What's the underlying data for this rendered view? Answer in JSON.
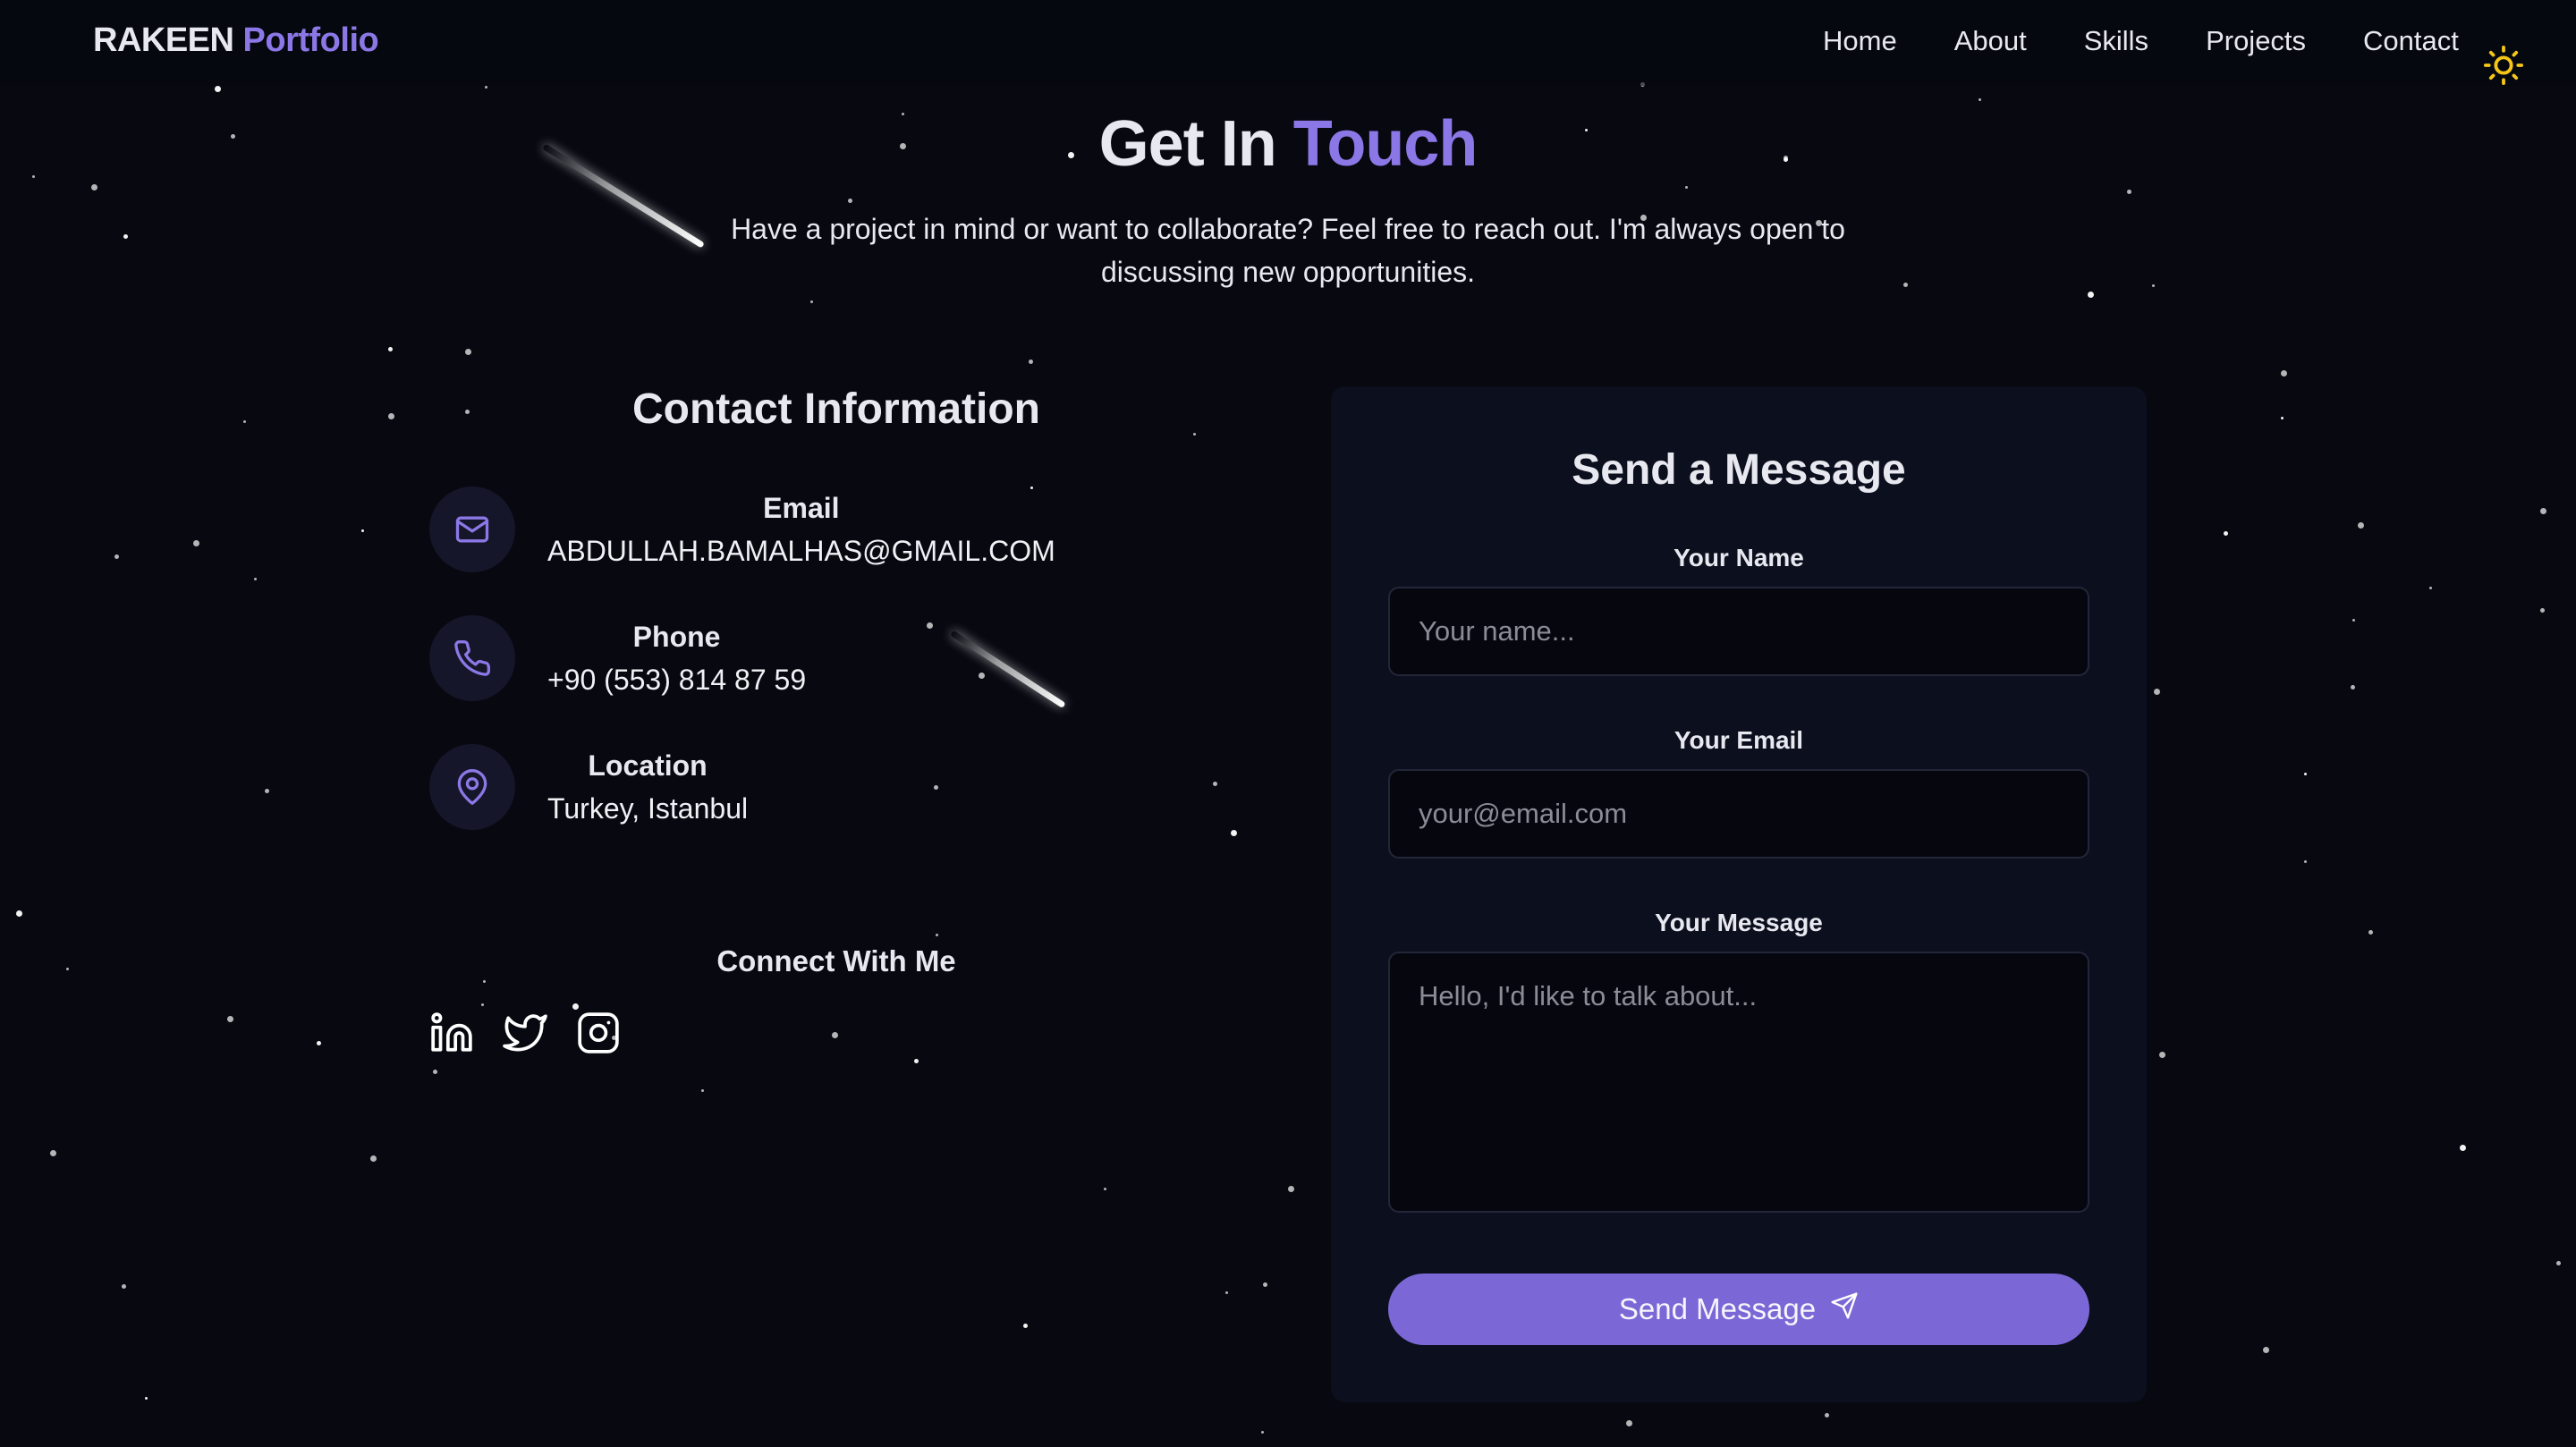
{
  "nav": {
    "brand_name": "RAKEEN",
    "brand_suffix": "Portfolio",
    "links": [
      "Home",
      "About",
      "Skills",
      "Projects",
      "Contact"
    ],
    "theme_icon": "sun-icon"
  },
  "hero": {
    "title_part1": "Get In",
    "title_part2": "Touch",
    "subtitle": "Have a project in mind or want to collaborate? Feel free to reach out. I'm always open to discussing new opportunities."
  },
  "contact_info": {
    "heading": "Contact Information",
    "items": [
      {
        "label": "Email",
        "value": "ABDULLAH.BAMALHAS@GMAIL.COM",
        "icon": "mail-icon"
      },
      {
        "label": "Phone",
        "value": "+90 (553) 814 87 59",
        "icon": "phone-icon"
      },
      {
        "label": "Location",
        "value": "Turkey, Istanbul",
        "icon": "map-pin-icon"
      }
    ],
    "connect_heading": "Connect With Me",
    "socials": [
      "linkedin-icon",
      "twitter-icon",
      "instagram-icon"
    ]
  },
  "form": {
    "heading": "Send a Message",
    "name_label": "Your Name",
    "name_placeholder": "Your name...",
    "email_label": "Your Email",
    "email_placeholder": "your@email.com",
    "message_label": "Your Message",
    "message_placeholder": "Hello, I'd like to talk about...",
    "submit_label": "Send Message",
    "submit_icon": "send-icon"
  },
  "colors": {
    "background": "#070810",
    "accent": "#8b78e6",
    "button": "#7b68d6",
    "card": "#0c0f1d",
    "sun": "#f5c518"
  }
}
